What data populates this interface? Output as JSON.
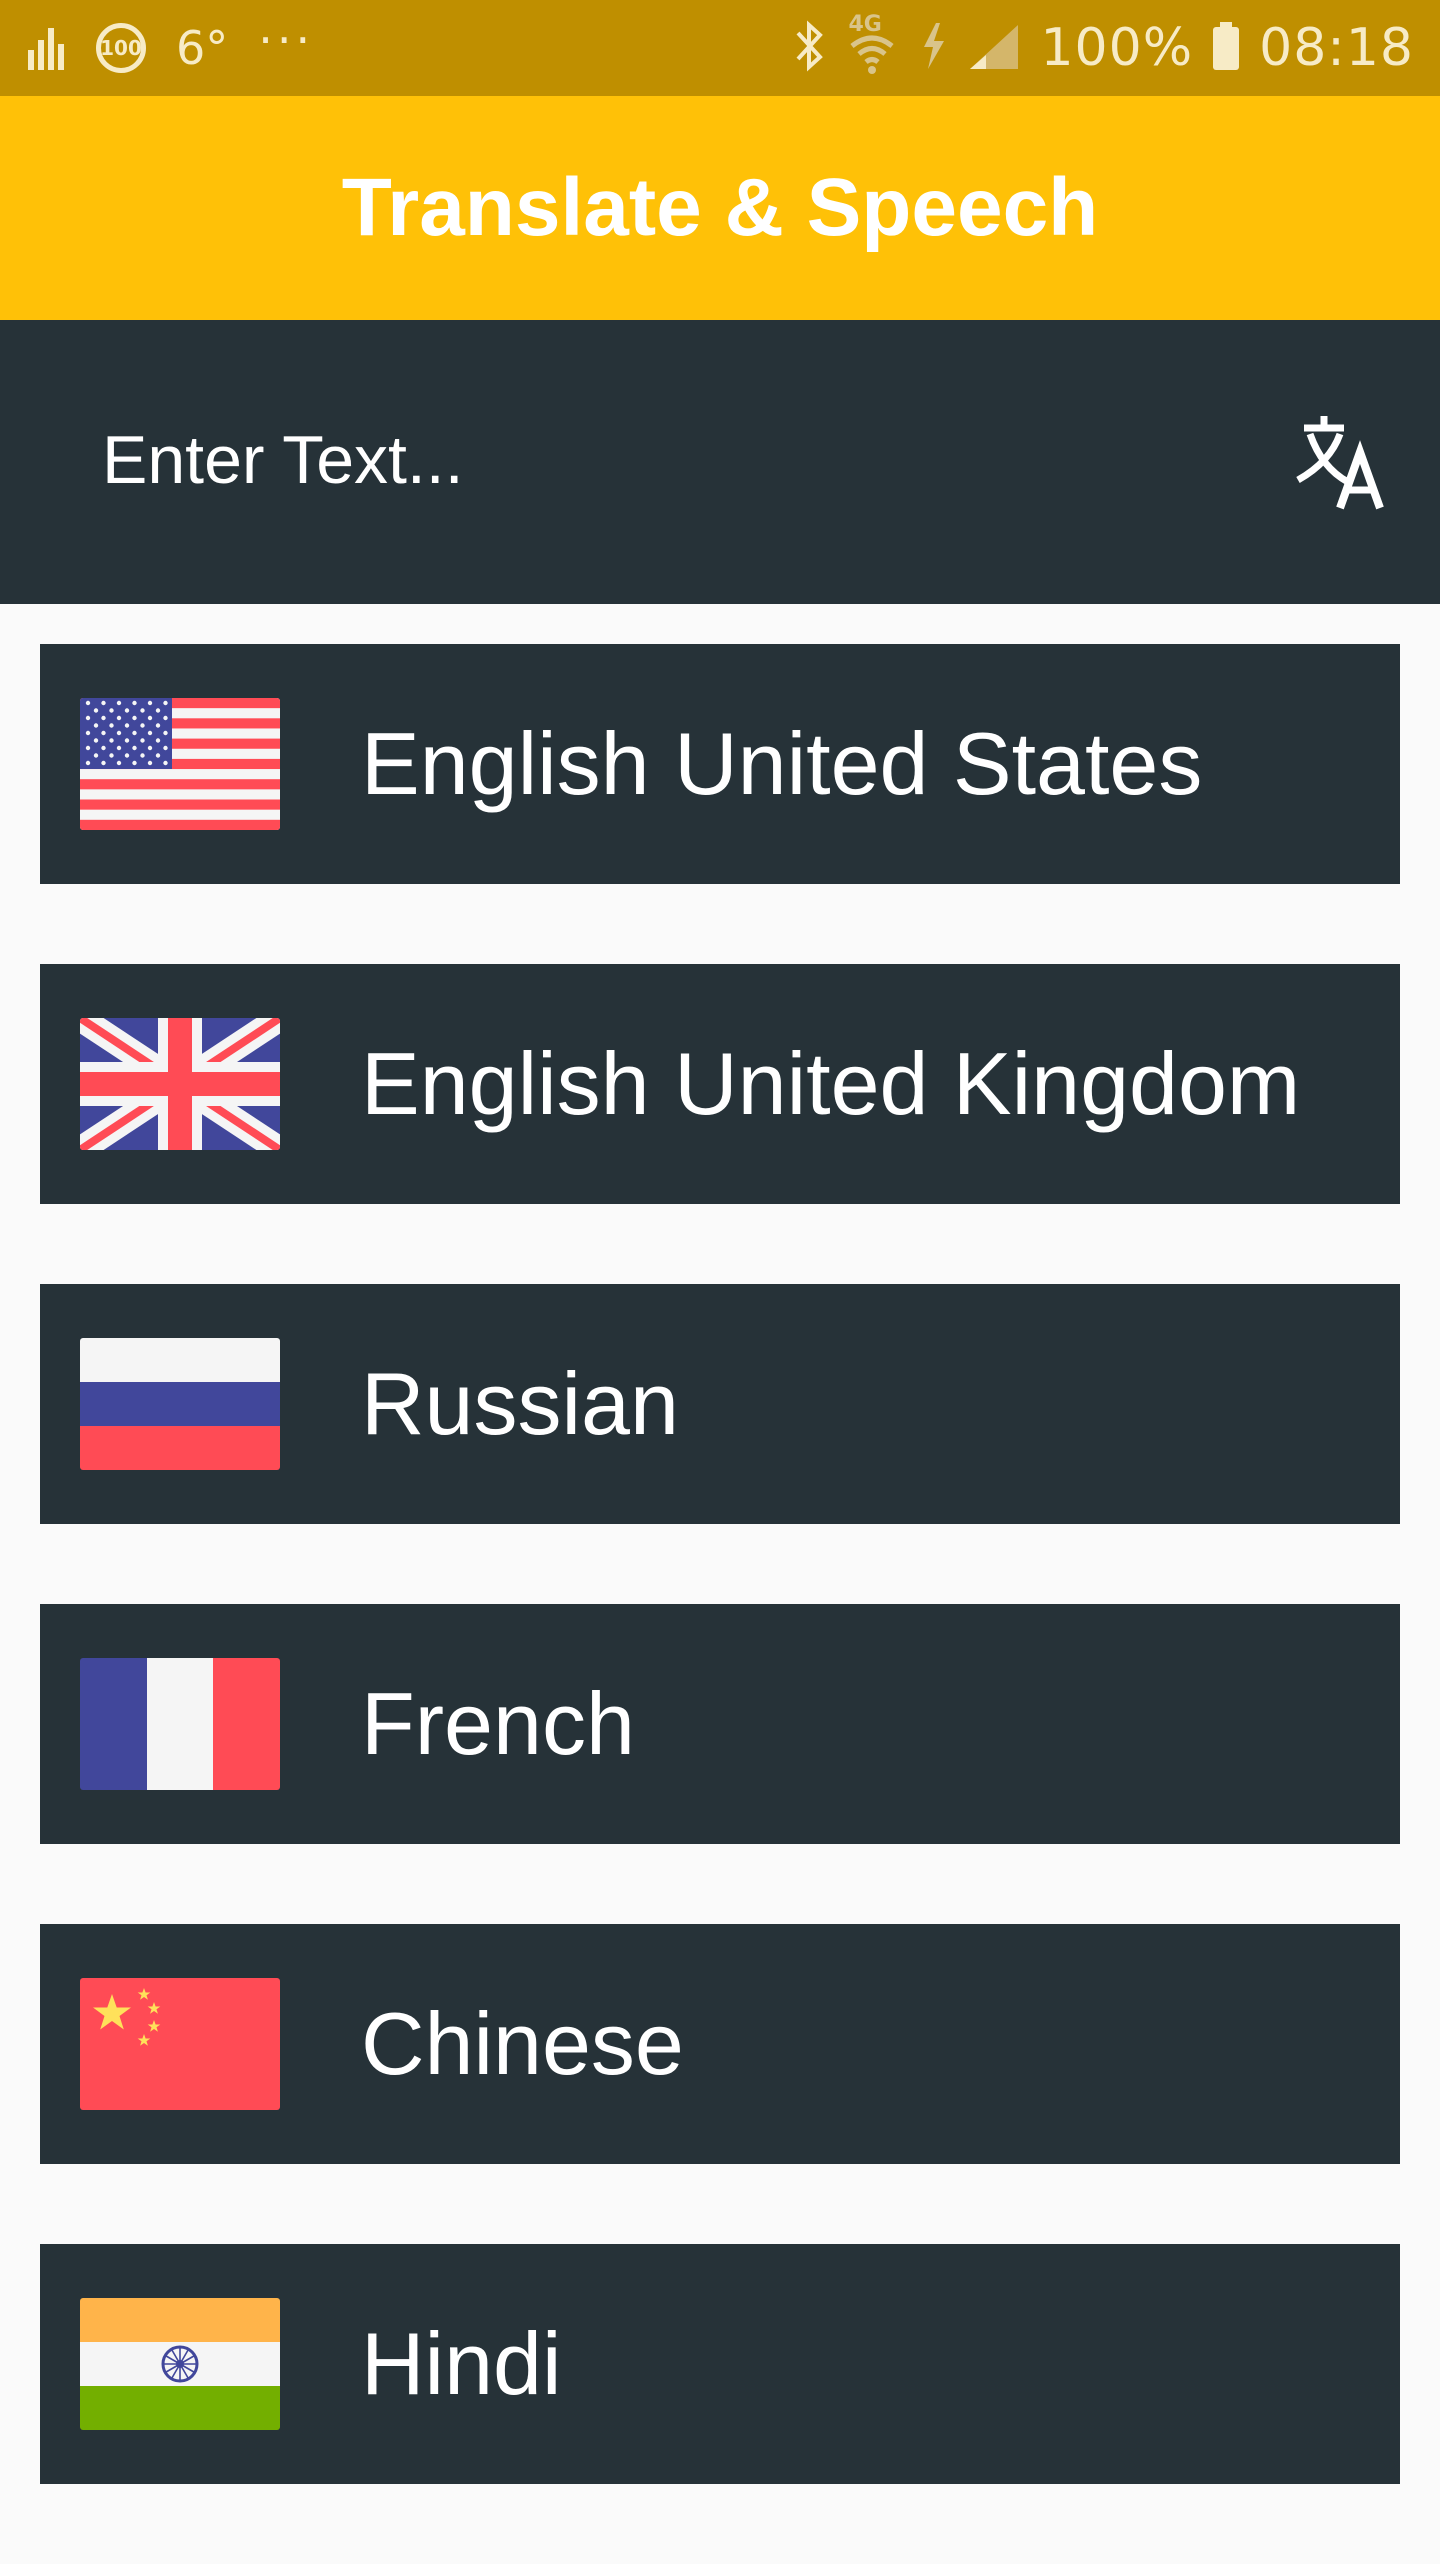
{
  "status_bar": {
    "temperature": "6°",
    "more_indicator": "···",
    "badge": "100",
    "network_label": "4G",
    "battery": "100%",
    "time": "08:18",
    "icons": [
      "signal-bars-icon",
      "badge-100-icon",
      "bluetooth-icon",
      "wifi-icon",
      "charging-icon",
      "cell-signal-icon",
      "battery-icon"
    ]
  },
  "app_bar": {
    "title": "Translate & Speech"
  },
  "input": {
    "placeholder": "Enter Text...",
    "value": "",
    "action_icon": "translate-icon"
  },
  "languages": [
    {
      "label": "English United States",
      "flag": "us-flag-icon"
    },
    {
      "label": "English United Kingdom",
      "flag": "uk-flag-icon"
    },
    {
      "label": "Russian",
      "flag": "russia-flag-icon"
    },
    {
      "label": "French",
      "flag": "france-flag-icon"
    },
    {
      "label": "Chinese",
      "flag": "china-flag-icon"
    },
    {
      "label": "Hindi",
      "flag": "india-flag-icon"
    }
  ],
  "colors": {
    "status_bar": "#bf8f00",
    "app_bar": "#ffc107",
    "panel": "#263238",
    "background": "#fafafa",
    "text": "#ffffff"
  }
}
